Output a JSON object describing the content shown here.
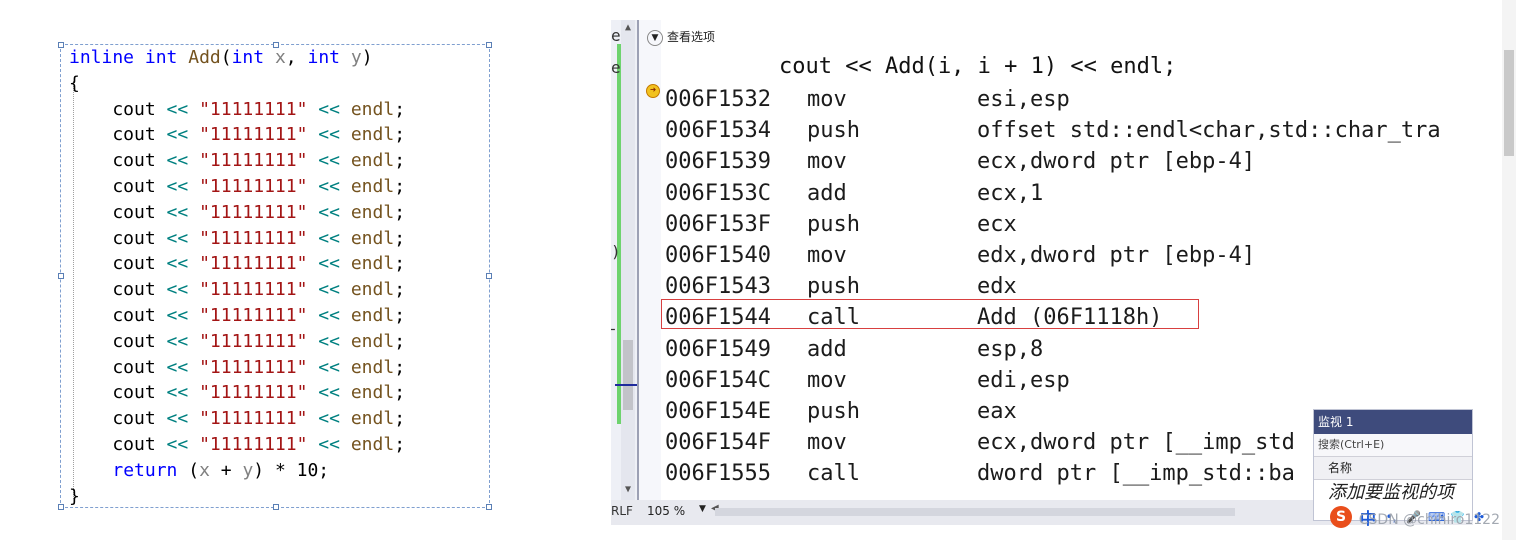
{
  "source_code": {
    "lines": [
      [
        {
          "t": "inline",
          "c": "kw"
        },
        {
          "t": " ",
          "c": "ident"
        },
        {
          "t": "int",
          "c": "kw"
        },
        {
          "t": " ",
          "c": "ident"
        },
        {
          "t": "Add",
          "c": "fn"
        },
        {
          "t": "(",
          "c": "ident"
        },
        {
          "t": "int",
          "c": "kw"
        },
        {
          "t": " ",
          "c": "ident"
        },
        {
          "t": "x",
          "c": "param"
        },
        {
          "t": ", ",
          "c": "ident"
        },
        {
          "t": "int",
          "c": "kw"
        },
        {
          "t": " ",
          "c": "ident"
        },
        {
          "t": "y",
          "c": "param"
        },
        {
          "t": ")",
          "c": "ident"
        }
      ],
      [
        {
          "t": "{",
          "c": "ident"
        }
      ],
      [
        {
          "t": "    cout ",
          "c": "ident"
        },
        {
          "t": "<<",
          "c": "op"
        },
        {
          "t": " ",
          "c": "ident"
        },
        {
          "t": "\"11111111\"",
          "c": "str"
        },
        {
          "t": " ",
          "c": "ident"
        },
        {
          "t": "<<",
          "c": "op"
        },
        {
          "t": " ",
          "c": "ident"
        },
        {
          "t": "endl",
          "c": "endl"
        },
        {
          "t": ";",
          "c": "ident"
        }
      ],
      [
        {
          "t": "    cout ",
          "c": "ident"
        },
        {
          "t": "<<",
          "c": "op"
        },
        {
          "t": " ",
          "c": "ident"
        },
        {
          "t": "\"11111111\"",
          "c": "str"
        },
        {
          "t": " ",
          "c": "ident"
        },
        {
          "t": "<<",
          "c": "op"
        },
        {
          "t": " ",
          "c": "ident"
        },
        {
          "t": "endl",
          "c": "endl"
        },
        {
          "t": ";",
          "c": "ident"
        }
      ],
      [
        {
          "t": "    cout ",
          "c": "ident"
        },
        {
          "t": "<<",
          "c": "op"
        },
        {
          "t": " ",
          "c": "ident"
        },
        {
          "t": "\"11111111\"",
          "c": "str"
        },
        {
          "t": " ",
          "c": "ident"
        },
        {
          "t": "<<",
          "c": "op"
        },
        {
          "t": " ",
          "c": "ident"
        },
        {
          "t": "endl",
          "c": "endl"
        },
        {
          "t": ";",
          "c": "ident"
        }
      ],
      [
        {
          "t": "    cout ",
          "c": "ident"
        },
        {
          "t": "<<",
          "c": "op"
        },
        {
          "t": " ",
          "c": "ident"
        },
        {
          "t": "\"11111111\"",
          "c": "str"
        },
        {
          "t": " ",
          "c": "ident"
        },
        {
          "t": "<<",
          "c": "op"
        },
        {
          "t": " ",
          "c": "ident"
        },
        {
          "t": "endl",
          "c": "endl"
        },
        {
          "t": ";",
          "c": "ident"
        }
      ],
      [
        {
          "t": "    cout ",
          "c": "ident"
        },
        {
          "t": "<<",
          "c": "op"
        },
        {
          "t": " ",
          "c": "ident"
        },
        {
          "t": "\"11111111\"",
          "c": "str"
        },
        {
          "t": " ",
          "c": "ident"
        },
        {
          "t": "<<",
          "c": "op"
        },
        {
          "t": " ",
          "c": "ident"
        },
        {
          "t": "endl",
          "c": "endl"
        },
        {
          "t": ";",
          "c": "ident"
        }
      ],
      [
        {
          "t": "    cout ",
          "c": "ident"
        },
        {
          "t": "<<",
          "c": "op"
        },
        {
          "t": " ",
          "c": "ident"
        },
        {
          "t": "\"11111111\"",
          "c": "str"
        },
        {
          "t": " ",
          "c": "ident"
        },
        {
          "t": "<<",
          "c": "op"
        },
        {
          "t": " ",
          "c": "ident"
        },
        {
          "t": "endl",
          "c": "endl"
        },
        {
          "t": ";",
          "c": "ident"
        }
      ],
      [
        {
          "t": "    cout ",
          "c": "ident"
        },
        {
          "t": "<<",
          "c": "op"
        },
        {
          "t": " ",
          "c": "ident"
        },
        {
          "t": "\"11111111\"",
          "c": "str"
        },
        {
          "t": " ",
          "c": "ident"
        },
        {
          "t": "<<",
          "c": "op"
        },
        {
          "t": " ",
          "c": "ident"
        },
        {
          "t": "endl",
          "c": "endl"
        },
        {
          "t": ";",
          "c": "ident"
        }
      ],
      [
        {
          "t": "    cout ",
          "c": "ident"
        },
        {
          "t": "<<",
          "c": "op"
        },
        {
          "t": " ",
          "c": "ident"
        },
        {
          "t": "\"11111111\"",
          "c": "str"
        },
        {
          "t": " ",
          "c": "ident"
        },
        {
          "t": "<<",
          "c": "op"
        },
        {
          "t": " ",
          "c": "ident"
        },
        {
          "t": "endl",
          "c": "endl"
        },
        {
          "t": ";",
          "c": "ident"
        }
      ],
      [
        {
          "t": "    cout ",
          "c": "ident"
        },
        {
          "t": "<<",
          "c": "op"
        },
        {
          "t": " ",
          "c": "ident"
        },
        {
          "t": "\"11111111\"",
          "c": "str"
        },
        {
          "t": " ",
          "c": "ident"
        },
        {
          "t": "<<",
          "c": "op"
        },
        {
          "t": " ",
          "c": "ident"
        },
        {
          "t": "endl",
          "c": "endl"
        },
        {
          "t": ";",
          "c": "ident"
        }
      ],
      [
        {
          "t": "    cout ",
          "c": "ident"
        },
        {
          "t": "<<",
          "c": "op"
        },
        {
          "t": " ",
          "c": "ident"
        },
        {
          "t": "\"11111111\"",
          "c": "str"
        },
        {
          "t": " ",
          "c": "ident"
        },
        {
          "t": "<<",
          "c": "op"
        },
        {
          "t": " ",
          "c": "ident"
        },
        {
          "t": "endl",
          "c": "endl"
        },
        {
          "t": ";",
          "c": "ident"
        }
      ],
      [
        {
          "t": "    cout ",
          "c": "ident"
        },
        {
          "t": "<<",
          "c": "op"
        },
        {
          "t": " ",
          "c": "ident"
        },
        {
          "t": "\"11111111\"",
          "c": "str"
        },
        {
          "t": " ",
          "c": "ident"
        },
        {
          "t": "<<",
          "c": "op"
        },
        {
          "t": " ",
          "c": "ident"
        },
        {
          "t": "endl",
          "c": "endl"
        },
        {
          "t": ";",
          "c": "ident"
        }
      ],
      [
        {
          "t": "    cout ",
          "c": "ident"
        },
        {
          "t": "<<",
          "c": "op"
        },
        {
          "t": " ",
          "c": "ident"
        },
        {
          "t": "\"11111111\"",
          "c": "str"
        },
        {
          "t": " ",
          "c": "ident"
        },
        {
          "t": "<<",
          "c": "op"
        },
        {
          "t": " ",
          "c": "ident"
        },
        {
          "t": "endl",
          "c": "endl"
        },
        {
          "t": ";",
          "c": "ident"
        }
      ],
      [
        {
          "t": "    cout ",
          "c": "ident"
        },
        {
          "t": "<<",
          "c": "op"
        },
        {
          "t": " ",
          "c": "ident"
        },
        {
          "t": "\"11111111\"",
          "c": "str"
        },
        {
          "t": " ",
          "c": "ident"
        },
        {
          "t": "<<",
          "c": "op"
        },
        {
          "t": " ",
          "c": "ident"
        },
        {
          "t": "endl",
          "c": "endl"
        },
        {
          "t": ";",
          "c": "ident"
        }
      ],
      [
        {
          "t": "    cout ",
          "c": "ident"
        },
        {
          "t": "<<",
          "c": "op"
        },
        {
          "t": " ",
          "c": "ident"
        },
        {
          "t": "\"11111111\"",
          "c": "str"
        },
        {
          "t": " ",
          "c": "ident"
        },
        {
          "t": "<<",
          "c": "op"
        },
        {
          "t": " ",
          "c": "ident"
        },
        {
          "t": "endl",
          "c": "endl"
        },
        {
          "t": ";",
          "c": "ident"
        }
      ],
      [
        {
          "t": "    ",
          "c": "ident"
        },
        {
          "t": "return",
          "c": "kw"
        },
        {
          "t": " (",
          "c": "ident"
        },
        {
          "t": "x",
          "c": "param"
        },
        {
          "t": " + ",
          "c": "ident"
        },
        {
          "t": "y",
          "c": "param"
        },
        {
          "t": ") * 10;",
          "c": "ident"
        }
      ],
      [
        {
          "t": "}",
          "c": "ident"
        }
      ]
    ]
  },
  "disassembly": {
    "options_label": "查看选项",
    "source_line": "cout << Add(i, i + 1) << endl;",
    "rows": [
      {
        "addr": "006F1532",
        "op": "mov",
        "arg": "esi,esp"
      },
      {
        "addr": "006F1534",
        "op": "push",
        "arg": "offset std::endl<char,std::char_tra"
      },
      {
        "addr": "006F1539",
        "op": "mov",
        "arg": "ecx,dword ptr [ebp-4]"
      },
      {
        "addr": "006F153C",
        "op": "add",
        "arg": "ecx,1"
      },
      {
        "addr": "006F153F",
        "op": "push",
        "arg": "ecx"
      },
      {
        "addr": "006F1540",
        "op": "mov",
        "arg": "edx,dword ptr [ebp-4]"
      },
      {
        "addr": "006F1543",
        "op": "push",
        "arg": "edx"
      },
      {
        "addr": "006F1544",
        "op": "call",
        "arg": "Add (06F1118h)"
      },
      {
        "addr": "006F1549",
        "op": "add",
        "arg": "esp,8"
      },
      {
        "addr": "006F154C",
        "op": "mov",
        "arg": "edi,esp"
      },
      {
        "addr": "006F154E",
        "op": "push",
        "arg": "eax"
      },
      {
        "addr": "006F154F",
        "op": "mov",
        "arg": "ecx,dword ptr [__imp_std"
      },
      {
        "addr": "006F1555",
        "op": "call",
        "arg": "dword ptr [__imp_std::ba"
      }
    ],
    "gutter_marks": [
      "e",
      "e",
      ")"
    ],
    "crlf": "RLF",
    "zoom": "105 %"
  },
  "watch": {
    "title": "监视 1",
    "search_placeholder": "搜索(Ctrl+E)",
    "column_name": "名称",
    "add_item": "添加要监视的项"
  },
  "ime": {
    "logo": "S",
    "mode": "中"
  },
  "watermark": "CSDN @chihiro1122",
  "colors": {
    "keyword": "#0000ff",
    "string": "#a31515",
    "operator": "#008080",
    "function": "#74531f",
    "highlight_box": "#d84040",
    "watch_title_bg": "#3e4b7c"
  }
}
